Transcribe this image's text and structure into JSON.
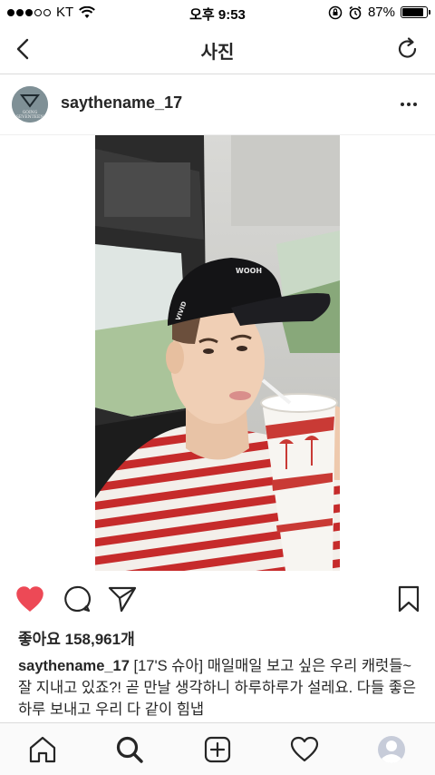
{
  "status_bar": {
    "carrier": "KT",
    "time": "오후 9:53",
    "battery": "87%",
    "battery_level": 0.87
  },
  "nav": {
    "title": "사진",
    "back_icon": "chevron-left-icon",
    "refresh_icon": "refresh-icon"
  },
  "post": {
    "username": "saythename_17",
    "avatar_text": "GOING SEVENTEEN",
    "more_icon": "more-horizontal-icon",
    "liked": true,
    "likes_text": "좋아요 158,961개",
    "caption_user": "saythename_17",
    "caption_text": " [17'S 슈아] 매일매일 보고 싶은 우리 캐럿들~ 잘 지내고 있죠?! 곧 만날 생각하니 하루하루가 설레요. 다들 좋은 하루 보내고 우리 다 같이 힘냅"
  },
  "photo_marks": {
    "cap_text": "VIVID",
    "cap_brand": "WOOH"
  },
  "colors": {
    "like_red": "#ed4956",
    "text": "#262626",
    "border": "#dbdbdb"
  },
  "tabs": [
    "home-icon",
    "search-icon",
    "add-icon",
    "activity-heart-icon",
    "profile-icon"
  ]
}
